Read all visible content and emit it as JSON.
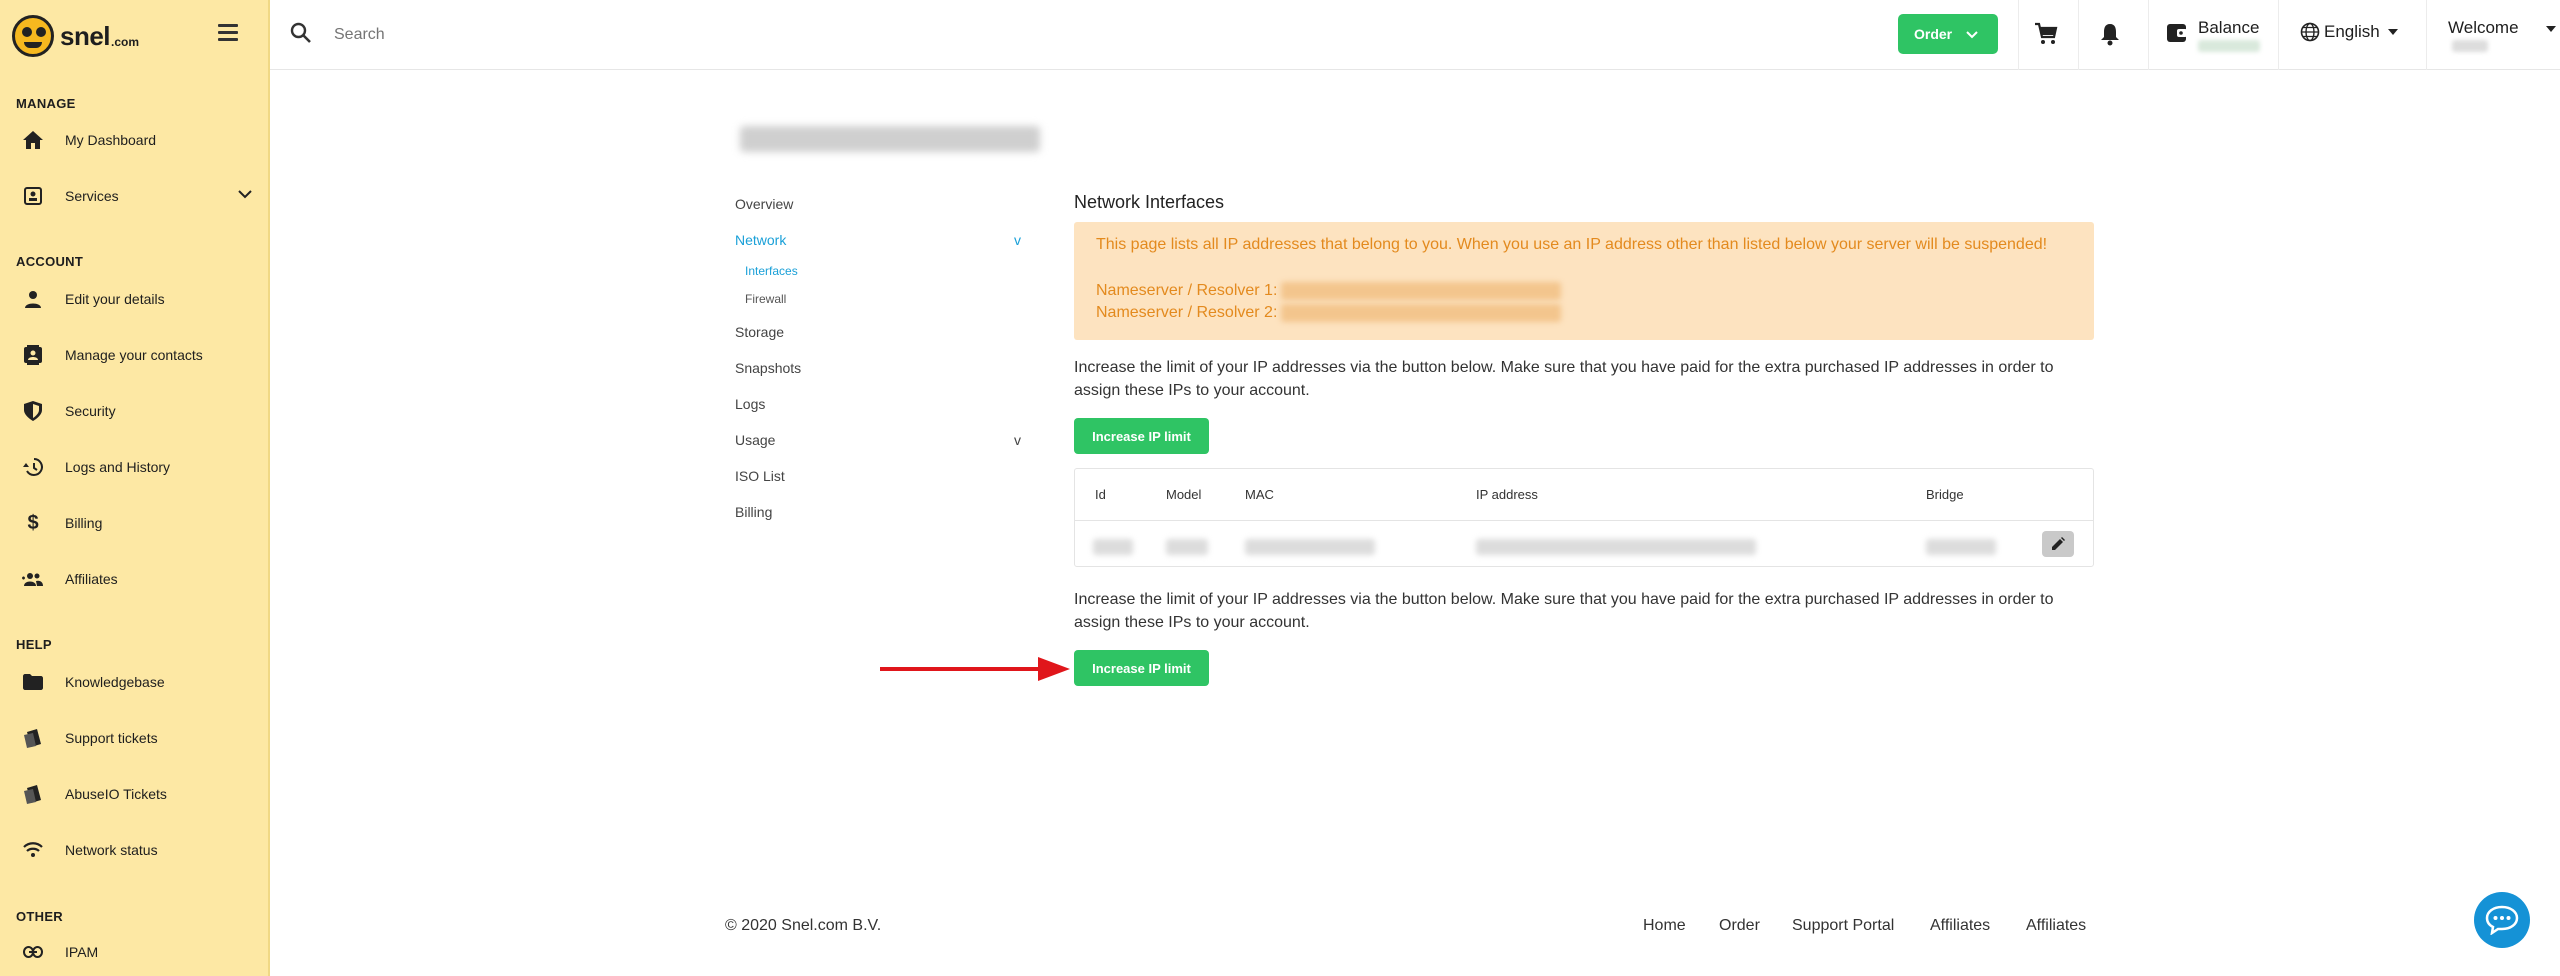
{
  "brand": {
    "name": "snel",
    "suffix": ".com"
  },
  "sidebar": {
    "sections": {
      "manage": "MANAGE",
      "account": "ACCOUNT",
      "help": "HELP",
      "other": "OTHER"
    },
    "items": [
      {
        "label": "My Dashboard",
        "icon": "home-icon"
      },
      {
        "label": "Services",
        "icon": "services-icon"
      },
      {
        "label": "Edit your details",
        "icon": "person-icon"
      },
      {
        "label": "Manage your contacts",
        "icon": "contacts-icon"
      },
      {
        "label": "Security",
        "icon": "shield-icon"
      },
      {
        "label": "Logs and History",
        "icon": "history-icon"
      },
      {
        "label": "Billing",
        "icon": "dollar-icon"
      },
      {
        "label": "Affiliates",
        "icon": "group-icon"
      },
      {
        "label": "Knowledgebase",
        "icon": "folder-icon"
      },
      {
        "label": "Support tickets",
        "icon": "tickets-icon"
      },
      {
        "label": "AbuseIO Tickets",
        "icon": "tickets-icon"
      },
      {
        "label": "Network status",
        "icon": "wifi-icon"
      },
      {
        "label": "IPAM",
        "icon": "link-icon"
      }
    ]
  },
  "topbar": {
    "search_placeholder": "Search",
    "order_label": "Order",
    "balance_label": "Balance",
    "language": "English",
    "welcome": "Welcome"
  },
  "subnav": {
    "items": {
      "overview": "Overview",
      "network": "Network",
      "interfaces": "Interfaces",
      "firewall": "Firewall",
      "storage": "Storage",
      "snapshots": "Snapshots",
      "logs": "Logs",
      "usage": "Usage",
      "iso": "ISO List",
      "billing": "Billing"
    },
    "chevron": "v"
  },
  "main": {
    "title": "Network Interfaces",
    "alert_text": "This page lists all IP addresses that belong to you. When you use an IP address other than listed below your server will be suspended!",
    "ns1_label": "Nameserver / Resolver 1:",
    "ns2_label": "Nameserver / Resolver 2:",
    "info_text": "Increase the limit of your IP addresses via the button below. Make sure that you have paid for the extra purchased IP addresses in order to assign these IPs to your account.",
    "button_label": "Increase IP limit",
    "table_headers": {
      "id": "Id",
      "model": "Model",
      "mac": "MAC",
      "ip": "IP address",
      "bridge": "Bridge"
    }
  },
  "footer": {
    "copyright": "© 2020 Snel.com B.V.",
    "links": [
      "Home",
      "Order",
      "Support Portal",
      "Affiliates",
      "Affiliates"
    ]
  },
  "colors": {
    "sidebar_bg": "#fde8a4",
    "accent_green": "#2fc464",
    "alert_bg": "#fde3c0",
    "alert_text": "#e38a1e",
    "link_active": "#1aa0d8",
    "arrow_red": "#e0161b",
    "chat_blue": "#1592d6"
  }
}
